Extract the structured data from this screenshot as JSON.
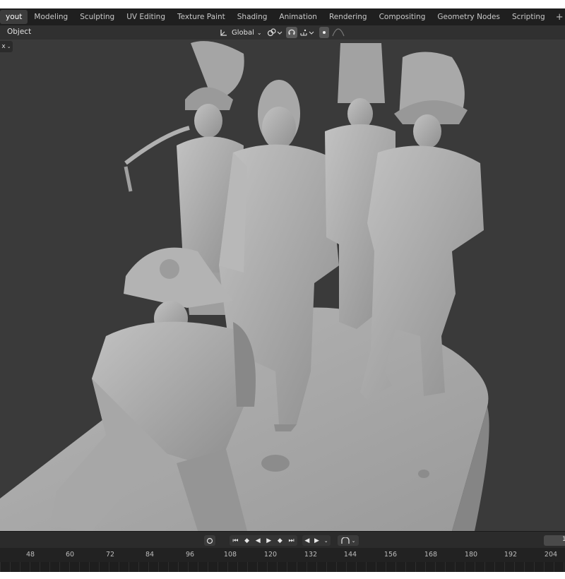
{
  "tabs": [
    "yout",
    "Modeling",
    "Sculpting",
    "UV Editing",
    "Texture Paint",
    "Shading",
    "Animation",
    "Rendering",
    "Compositing",
    "Geometry Nodes",
    "Scripting"
  ],
  "active_tab": 0,
  "header": {
    "object_menu": "Object",
    "transform_orientation": "Global",
    "mode_dropdown": "x"
  },
  "icons": [
    "add-workspace-icon",
    "transform-orientation-icon",
    "pivot-icon",
    "snap-icon",
    "snap-target-icon",
    "proportional-edit-icon",
    "falloff-icon",
    "record-icon",
    "jump-start-icon",
    "prev-keyframe-icon",
    "play-reverse-icon",
    "play-icon",
    "next-keyframe-icon",
    "jump-end-icon",
    "keying-icon",
    "auto-key-icon"
  ],
  "timeline": {
    "frame_value": "1",
    "ruler_ticks": [
      "48",
      "60",
      "72",
      "84",
      "96",
      "108",
      "120",
      "132",
      "144",
      "156",
      "168",
      "180",
      "192",
      "204"
    ]
  },
  "colors": {
    "active_tab": "#3d3d3d",
    "viewport": "#3a3a3a",
    "model": "#a9a9a9"
  }
}
